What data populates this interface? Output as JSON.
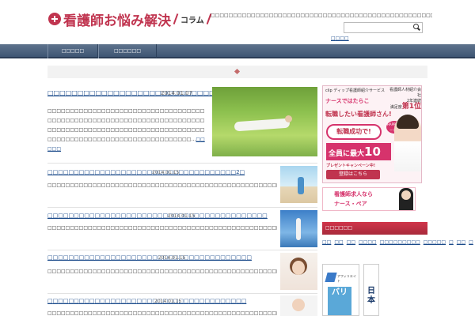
{
  "header": {
    "logo_main": "看護師お悩み解決",
    "logo_sub": "コラム",
    "tagline": "□□□□□□□□□□□□□□□□□□□□□□□□□□□□□□□□□□□□□□□□□□□□□□□□□□□□□□□□□□□□□□",
    "search_placeholder": "",
    "sitemap_label": "□□□□"
  },
  "nav": {
    "items": [
      {
        "label": "□□□□□"
      },
      {
        "label": "□□□□□□"
      }
    ]
  },
  "feature": {
    "title": "□□□□□□□□□□□□□□□□□□□□□□□□□□□□□□□□",
    "date": "2014.01.07",
    "body": "□□□□□□□□□□□□□□□□□□□□□□□□□□□□□□□□□□□□□□□□□□□□□□□□□□□□□□□□□□□□□□□□□□□□□□□□□□□□□□□□□□□□□□□□□□□□□□□□□□□□□□□□□□□□□□□□□□□□□□□□□□□□□□□□□□□□□□□□□",
    "more": "□□□□□"
  },
  "posts": [
    {
      "title": "□□□□□□□□□□□□□□□□□□□□□□□□□□□□□□□□□□□□2□",
      "date": "2014.01.15",
      "body": "□□□□□□□□□□□□□□□□□□□□□□□□□□□□□□□□□□□□□□□□□□□□□□□□□□□□□□□□□□□□□□□",
      "more": "□□□□□"
    },
    {
      "title": "□□□□□□□□□□□□□□□□□□□□□□□□□□□□□□□□□□□□□□□□□□",
      "date": "2014.01.15",
      "body": "□□□□□□□□□□□□□□□□□□□□□□□□□□□□□□□□□□□□□□□□□□□□□□□□□□□□□□□□□□□□□□□",
      "more": "□□□□□"
    },
    {
      "title": "□□□□□□□□□□□□□□□□□□□□□□□□□□□□□□□□□□□□□□□",
      "date": "2014.01.15",
      "body": "□□□□□□□□□□□□□□□□□□□□□□□□□□□□□□□□□□□□□□□□□□□□□□□□□□□□□□□□□□□□□□□",
      "more": "□□□□□"
    },
    {
      "title": "□□□□□□□□□□□□□□□□□□□□□□□□□□□□□□□□□□□□□□",
      "date": "2014.01.15",
      "body": "□□□□□□□□□□□□□□□□□□□□□□□□□□□□□□□□□□□□□□□□□□□□□□□□□□□□□□□□□□□□□□□",
      "more": "□□□□□"
    }
  ],
  "sidebar": {
    "ad1": {
      "top_text": "clip ディップ看護師紹介サービス",
      "brand": "ナースではたらこ",
      "rank_text": "看護師人材紹介会社",
      "rank_line2": "2年連続",
      "rank_line3": "満足度",
      "rank_main": "第1位",
      "headline": "転職したい看護師さん!",
      "bubble": "転職成功で!",
      "happy": "HAPPY ボーナス",
      "money_prefix": "全員に最大",
      "money_amount": "10万円",
      "campaign": "プレゼントキャンペーン中!",
      "button": "登録はこちら"
    },
    "ad2": {
      "line1": "看護師求人なら",
      "line2": "ナース・ペア"
    },
    "widget_title": "□□□□□□",
    "tags": [
      "□□",
      "□□",
      "□□",
      "□□□□",
      "□□□□□□□□□",
      "□□□□□",
      "□",
      "□□",
      "□",
      "□□",
      "□□"
    ],
    "ad3": {
      "label": "アフィリエイト",
      "vertical": "バリ"
    },
    "ad4": {
      "vertical": "日本"
    }
  }
}
